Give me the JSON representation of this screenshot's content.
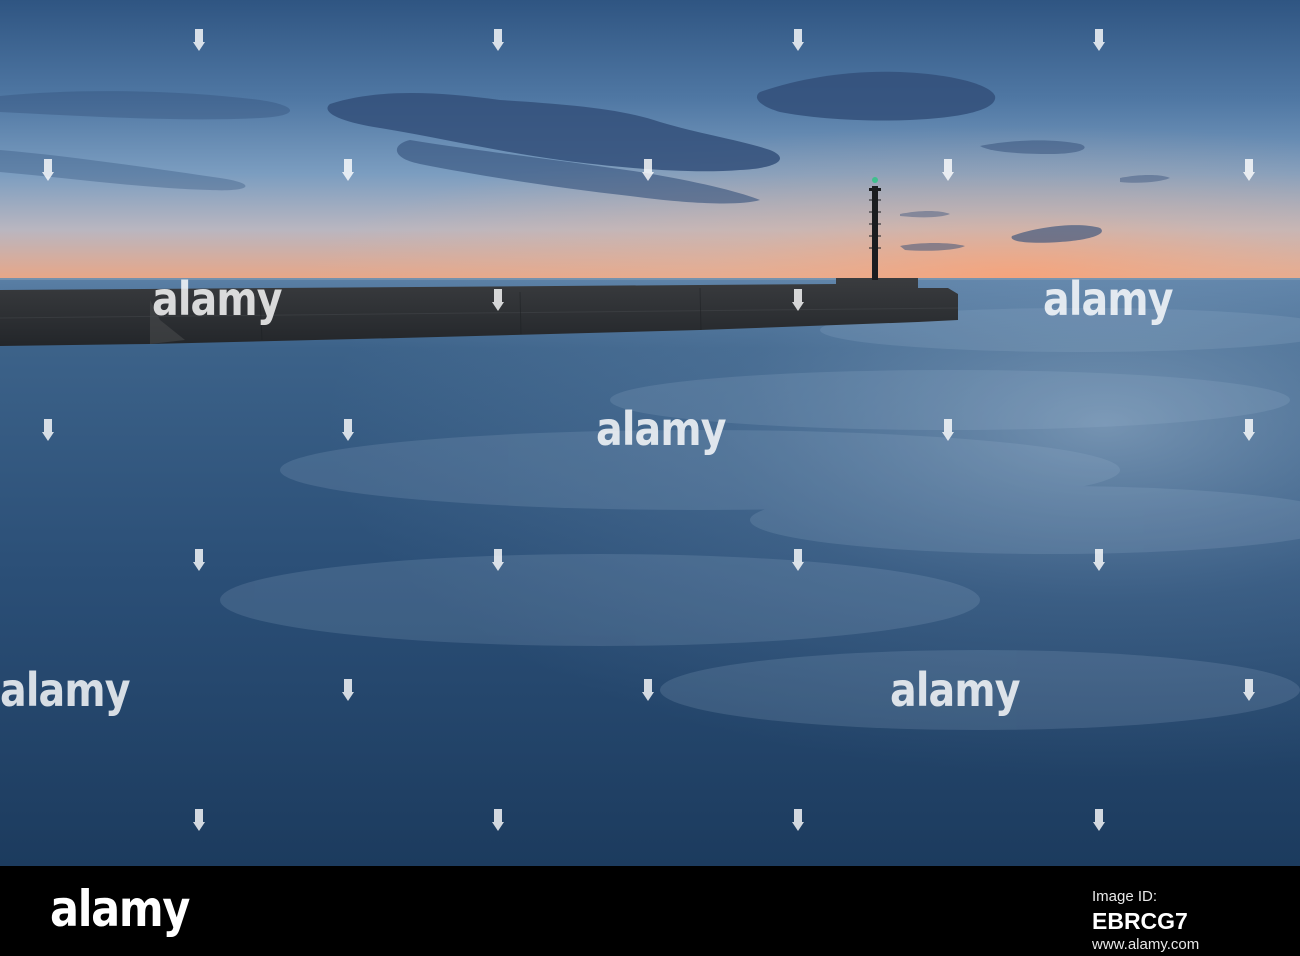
{
  "photo": {
    "watermark_text": "alamy",
    "palette": {
      "sky_top": "#2f5582",
      "sky_mid": "#6d93b9",
      "sky_horizon": "#f0a07a",
      "sea_far": "#4d7196",
      "sea_near": "#1d3e61",
      "pier": "#2c3035",
      "cloud": "#34507a"
    }
  },
  "footer": {
    "logo": "alamy",
    "label": "Image ID:",
    "image_id": "EBRCG7",
    "www": "www.alamy.com"
  }
}
